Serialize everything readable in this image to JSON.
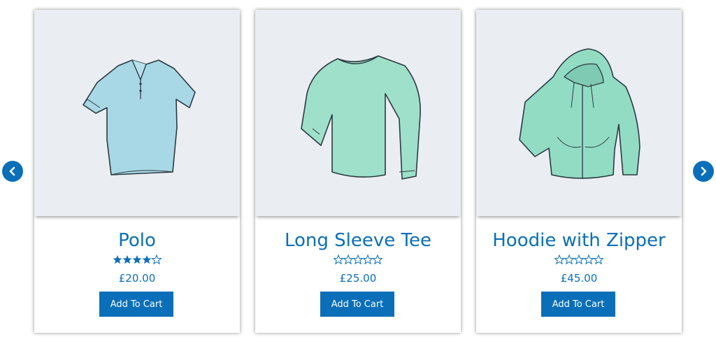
{
  "products": [
    {
      "title": "Polo",
      "price": "£20.00",
      "button": "Add To Cart",
      "rating": 4.5,
      "image": "polo-shirt-image"
    },
    {
      "title": "Long Sleeve Tee",
      "price": "£25.00",
      "button": "Add To Cart",
      "rating": 0,
      "image": "long-sleeve-tee-image"
    },
    {
      "title": "Hoodie with Zipper",
      "price": "£45.00",
      "button": "Add To Cart",
      "rating": 0,
      "image": "zip-hoodie-image"
    }
  ],
  "nav": {
    "prev_icon": "chevron-left-icon",
    "next_icon": "chevron-right-icon"
  },
  "colors": {
    "accent": "#0a6fb8",
    "thumb_bg": "#eaeef2",
    "polo_fill": "#a8d8e6",
    "tee_fill": "#9fe0cb",
    "hoodie_fill": "#92dcc4"
  }
}
